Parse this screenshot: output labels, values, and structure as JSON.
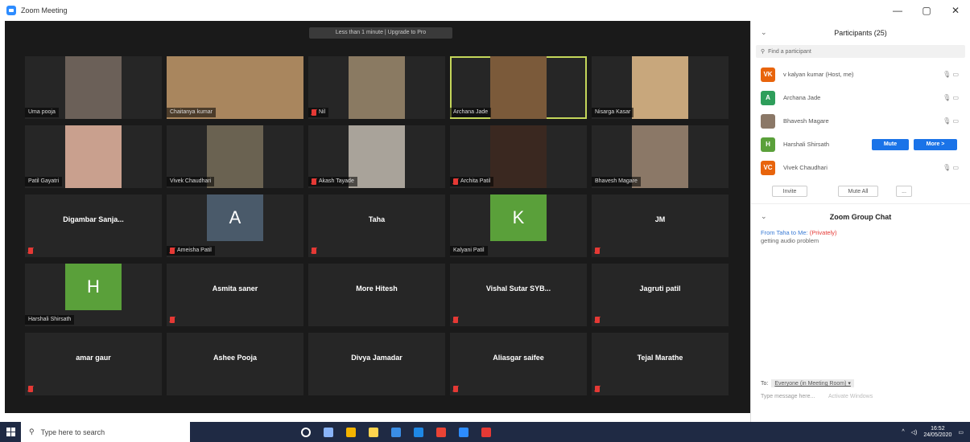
{
  "window": {
    "title": "Zoom Meeting",
    "controls": [
      "—",
      "▢",
      "✕"
    ]
  },
  "banner": "Less than 1 minute | Upgrade to Pro",
  "tiles": [
    {
      "name": "Uma pooja",
      "type": "photo",
      "bg": "#6b6058"
    },
    {
      "name": "Chaitanya kumar",
      "type": "photo-wide",
      "bg": "#a9865e"
    },
    {
      "name": "Nil",
      "type": "photo",
      "bg": "#8a7a62",
      "muted": true
    },
    {
      "name": "Archana Jade",
      "type": "photo",
      "bg": "#7b5a3a",
      "active": true
    },
    {
      "name": "Nisarga Kasar",
      "type": "photo",
      "bg": "#c8a77c"
    },
    {
      "name": "Patil Gayatri",
      "type": "photo",
      "bg": "#c9a08e"
    },
    {
      "name": "Vivek Chaudhari",
      "type": "photo",
      "bg": "#6a6251"
    },
    {
      "name": "Akash Tayade",
      "type": "photo",
      "bg": "#a9a39a",
      "muted": true
    },
    {
      "name": "Archita Patil",
      "type": "photo",
      "bg": "#3a2820",
      "muted": true
    },
    {
      "name": "Bhavesh Magare",
      "type": "photo",
      "bg": "#8b7867"
    },
    {
      "name": "Digambar  Sanja...",
      "type": "text",
      "muted": true
    },
    {
      "name": "A",
      "caption": "Ameisha Patil",
      "type": "avatar",
      "bg": "#4a5a6a",
      "muted": true
    },
    {
      "name": "Taha",
      "type": "text",
      "muted": true
    },
    {
      "name": "K",
      "caption": "Kalyani Patil",
      "type": "avatar",
      "bg": "#5aa03a"
    },
    {
      "name": "JM",
      "type": "text",
      "muted": true
    },
    {
      "name": "H",
      "caption": "Harshali Shirsath",
      "type": "avatar",
      "bg": "#5aa03a"
    },
    {
      "name": "Asmita saner",
      "type": "text",
      "muted": true
    },
    {
      "name": "More Hitesh",
      "type": "text"
    },
    {
      "name": "Vishal Sutar SYB...",
      "type": "text",
      "muted": true
    },
    {
      "name": "Jagruti patil",
      "type": "text",
      "muted": true
    },
    {
      "name": "amar gaur",
      "type": "text",
      "muted": true
    },
    {
      "name": "Ashee Pooja",
      "type": "text"
    },
    {
      "name": "Divya Jamadar",
      "type": "text"
    },
    {
      "name": "Aliasgar saifee",
      "type": "text",
      "muted": true
    },
    {
      "name": "Tejal Marathe",
      "type": "text",
      "muted": true
    }
  ],
  "participants": {
    "title": "Participants (25)",
    "search_placeholder": "Find a participant",
    "rows": [
      {
        "initials": "VK",
        "color": "#e8640c",
        "name": "v kalyan kumar (Host, me)"
      },
      {
        "initials": "A",
        "color": "#2e9e5b",
        "name": "Archana Jade"
      },
      {
        "initials": "",
        "color": "#8b7867",
        "name": "Bhavesh Magare"
      },
      {
        "initials": "H",
        "color": "#5aa03a",
        "name": "Harshali Shirsath"
      },
      {
        "initials": "VC",
        "color": "#e8640c",
        "name": "Vivek Chaudhari"
      }
    ],
    "mute_label": "Mute",
    "more_label": "More >",
    "invite_label": "Invite",
    "mute_all_label": "Mute All",
    "more_dots": "..."
  },
  "chat": {
    "title": "Zoom Group Chat",
    "from": "From Taha to Me:",
    "private": "(Privately)",
    "message": "getting audio problem",
    "to_label": "To:",
    "to_value": "Everyone (in Meeting Room) ▾",
    "type_hint": "Type message here...",
    "activate": "Activate Windows"
  },
  "taskbar": {
    "search_placeholder": "Type here to search",
    "time": "16:52",
    "date": "24/05/2020",
    "apps": [
      "#ffffff",
      "#8ab4f8",
      "#f4b400",
      "#ffd54f",
      "#3a8ee6",
      "#1e88e5",
      "#ea4335",
      "#2D8CFF",
      "#e53935"
    ]
  }
}
